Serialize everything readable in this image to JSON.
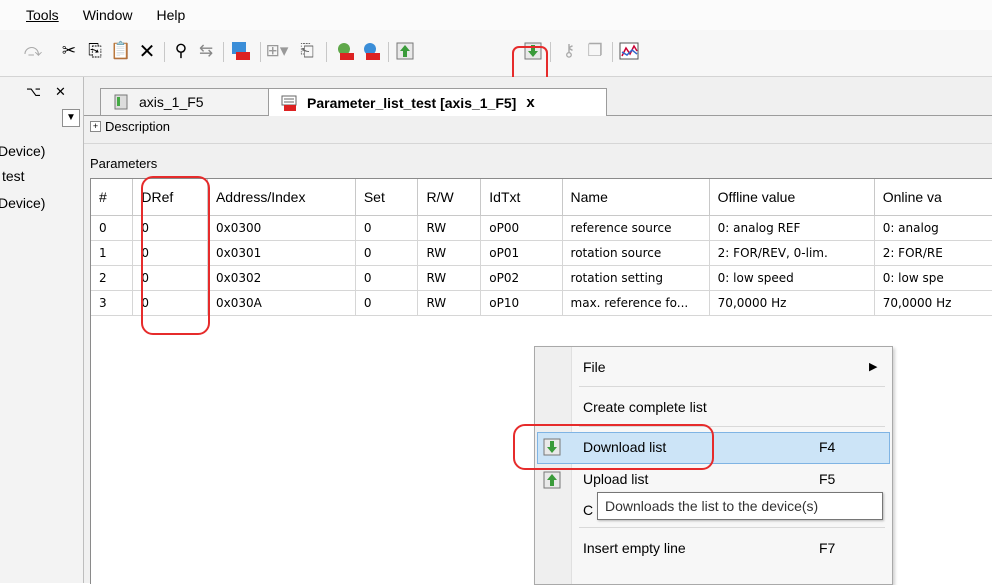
{
  "menubar": {
    "items": [
      "Tools",
      "Window",
      "Help"
    ]
  },
  "toolbar": {
    "icons": [
      "redo-icon",
      "cut-icon",
      "copy-icon",
      "paste-icon",
      "delete-icon",
      "find-icon",
      "replace-icon",
      "keb-device-icon",
      "insert-icon",
      "open-icon",
      "keb-read-icon",
      "keb-write-icon",
      "upload-icon",
      "download-icon",
      "key-icon",
      "copy-list-icon",
      "scope-icon"
    ]
  },
  "leftdock": {
    "pin": "⌥",
    "close": "✕",
    "items": [
      "Device)",
      "test",
      "Device)"
    ]
  },
  "tabs": [
    {
      "label": "axis_1_F5",
      "active": false
    },
    {
      "label": "Parameter_list_test [axis_1_F5]",
      "active": true,
      "close": "x"
    }
  ],
  "description_label": "Description",
  "parameters_label": "Parameters",
  "grid": {
    "columns": [
      "#",
      "DRef",
      "Address/Index",
      "Set",
      "R/W",
      "IdTxt",
      "Name",
      "Offline value",
      "Online va"
    ],
    "rows": [
      [
        "0",
        "0",
        "0x0300",
        "0",
        "RW",
        "oP00",
        "reference source",
        "0: analog REF",
        "0: analog"
      ],
      [
        "1",
        "0",
        "0x0301",
        "0",
        "RW",
        "oP01",
        "rotation source",
        "2: FOR/REV, 0-lim.",
        "2: FOR/RE"
      ],
      [
        "2",
        "0",
        "0x0302",
        "0",
        "RW",
        "oP02",
        "rotation setting",
        "0: low speed",
        "0: low spe"
      ],
      [
        "3",
        "0",
        "0x030A",
        "0",
        "RW",
        "oP10",
        "max. reference fo...",
        "70,0000 Hz",
        "70,0000 Hz"
      ]
    ]
  },
  "context_menu": {
    "items": [
      {
        "label": "File",
        "shortcut": ""
      },
      {
        "label": "Create complete list",
        "shortcut": ""
      },
      {
        "label": "Download list",
        "shortcut": "F4"
      },
      {
        "label": "Upload list",
        "shortcut": "F5"
      },
      {
        "label": "C",
        "shortcut": ""
      },
      {
        "label": "Insert empty line",
        "shortcut": "F7"
      }
    ]
  },
  "tooltip": "Downloads the list to the device(s)",
  "colors": {
    "highlight": "#e62b2b",
    "selection": "#cce4f7",
    "keb_red": "#d22"
  }
}
